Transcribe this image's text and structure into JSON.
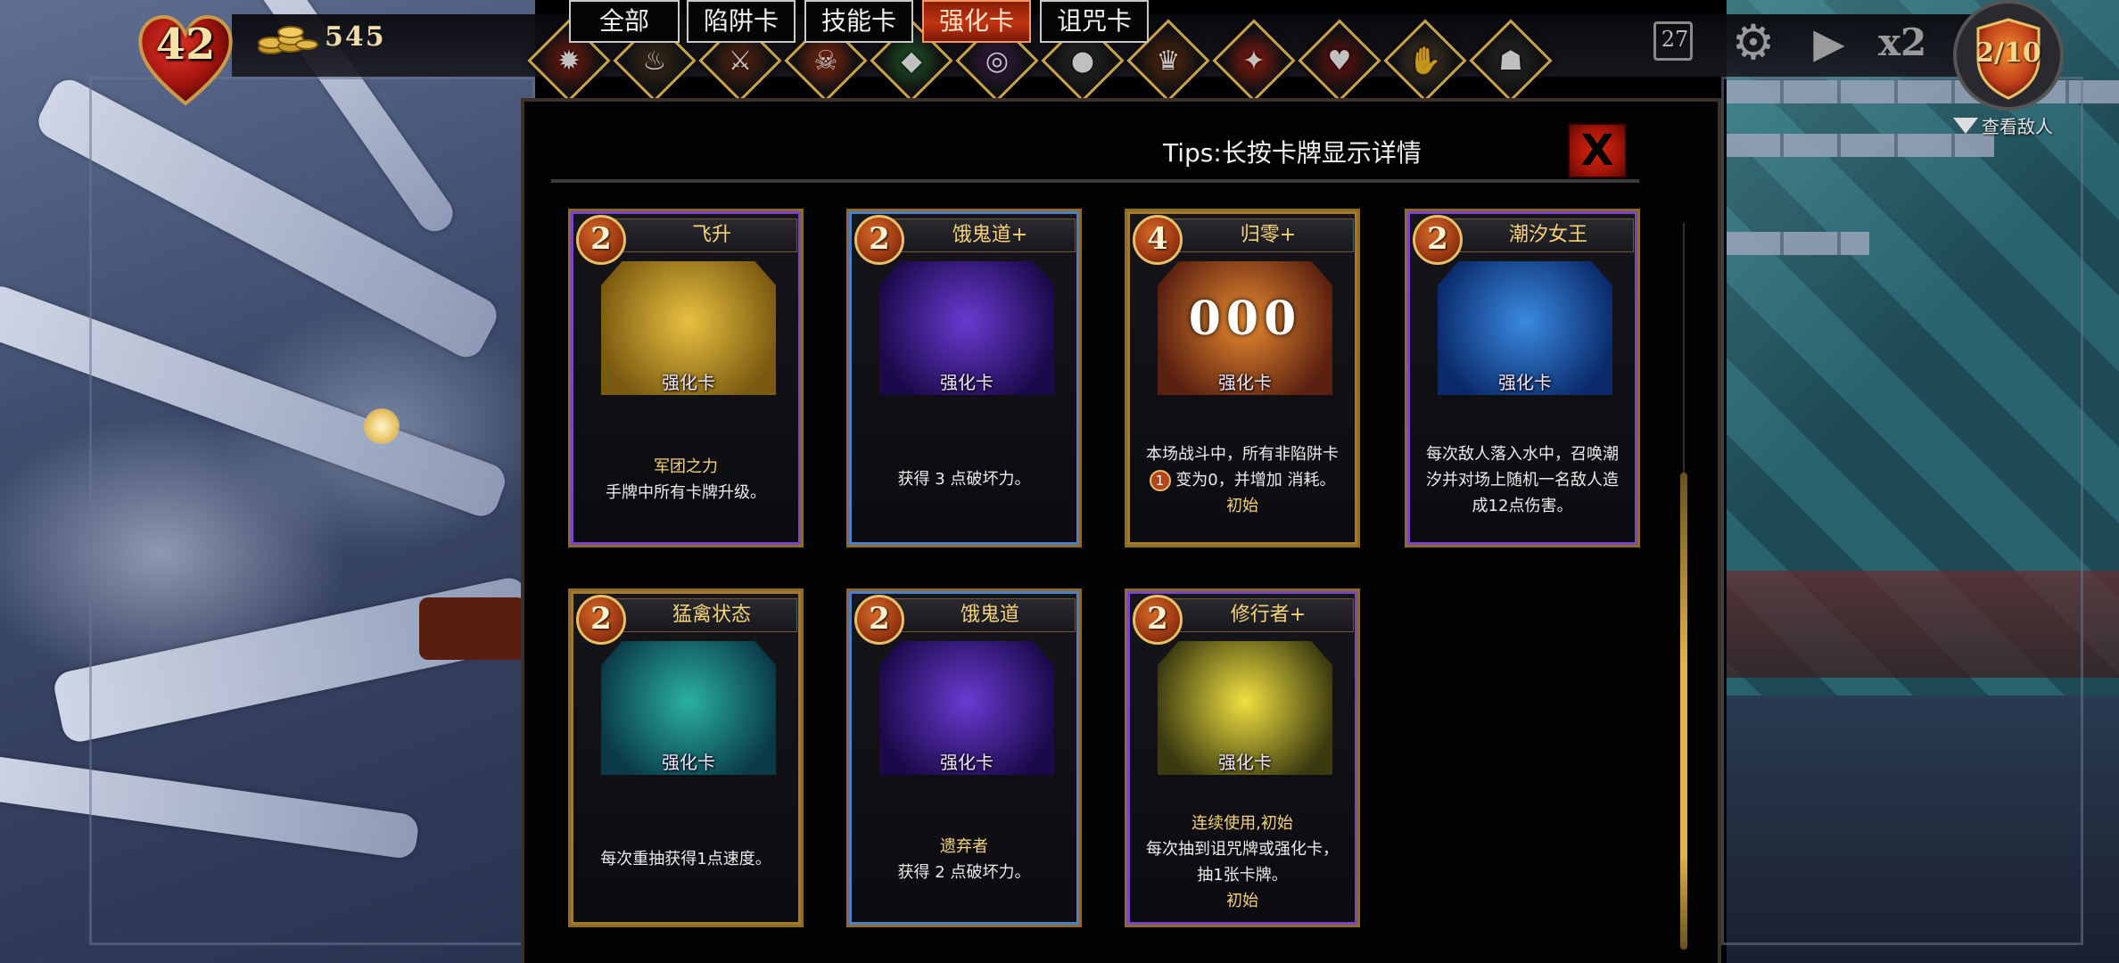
{
  "hud": {
    "hp": "42",
    "gold": "545",
    "deck_count": "27",
    "speed": "x2",
    "wave": "2/10",
    "view_enemy": "查看敌人"
  },
  "relics": [
    {
      "name": "thorn-relic-icon",
      "color": "#7a1a10"
    },
    {
      "name": "cauldron-relic-icon",
      "color": "#3b2a1a"
    },
    {
      "name": "blade-relic-icon",
      "color": "#5a2410"
    },
    {
      "name": "demon-relic-icon",
      "color": "#8a2a10"
    },
    {
      "name": "emerald-relic-icon",
      "color": "#1f5a2a"
    },
    {
      "name": "ring-relic-icon",
      "color": "#3a1a4a"
    },
    {
      "name": "orb-relic-icon",
      "color": "#2a2a2a"
    },
    {
      "name": "crown-relic-icon",
      "color": "#5a2a10"
    },
    {
      "name": "gem-relic-icon",
      "color": "#8a1a10"
    },
    {
      "name": "heart-relic-icon",
      "color": "#6a1010"
    },
    {
      "name": "hand-relic-icon",
      "color": "#4a3a2a"
    },
    {
      "name": "beast-relic-icon",
      "color": "#2a2a2a"
    }
  ],
  "tabs": [
    "全部",
    "陷阱卡",
    "技能卡",
    "强化卡",
    "诅咒卡"
  ],
  "active_tab": "强化卡",
  "tips": "Tips:长按卡牌显示详情",
  "close_label": "X",
  "cards": [
    {
      "title": "飞升",
      "cost": "2",
      "type": "强化卡",
      "keyword": "军团之力",
      "lines": [
        "手牌中所有卡牌升级。"
      ],
      "art_colors": [
        "#e8c040",
        "#7a5a10"
      ]
    },
    {
      "title": "饿鬼道+",
      "cost": "2",
      "type": "强化卡",
      "lines": [
        "获得 3 点破坏力。"
      ],
      "art_colors": [
        "#6a3ad0",
        "#1a0a4a"
      ]
    },
    {
      "title": "归零+",
      "cost": "4",
      "type": "强化卡",
      "lines": [
        "本场战斗中，所有非陷阱卡",
        "变为0，并增加 消耗。"
      ],
      "inline_cost": "1",
      "keyword_after": "初始",
      "art_text": "000",
      "art_colors": [
        "#e88a30",
        "#5a2010"
      ]
    },
    {
      "title": "潮汐女王",
      "cost": "2",
      "type": "强化卡",
      "lines": [
        "每次敌人落入水中，召唤潮",
        "汐并对场上随机一名敌人造",
        "成12点伤害。"
      ],
      "art_colors": [
        "#3a8ae0",
        "#0a2a6a"
      ]
    },
    {
      "title": "猛禽状态",
      "cost": "2",
      "type": "强化卡",
      "lines": [
        "每次重抽获得1点速度。"
      ],
      "art_colors": [
        "#2ab0a0",
        "#0a3a4a"
      ]
    },
    {
      "title": "饿鬼道",
      "cost": "2",
      "type": "强化卡",
      "keyword": "遗弃者",
      "lines": [
        "获得 2 点破坏力。"
      ],
      "art_colors": [
        "#6a3ad0",
        "#1a0a4a"
      ]
    },
    {
      "title": "修行者+",
      "cost": "2",
      "type": "强化卡",
      "keyword": "连续使用,初始",
      "lines": [
        "每次抽到诅咒牌或强化卡，",
        "抽1张卡牌。"
      ],
      "keyword_after": "初始",
      "art_colors": [
        "#f0e040",
        "#3a3a10"
      ]
    }
  ],
  "colors": {
    "accent_gold": "#f5d37a",
    "active_tab": "#c13510",
    "close_red": "#d42810"
  }
}
